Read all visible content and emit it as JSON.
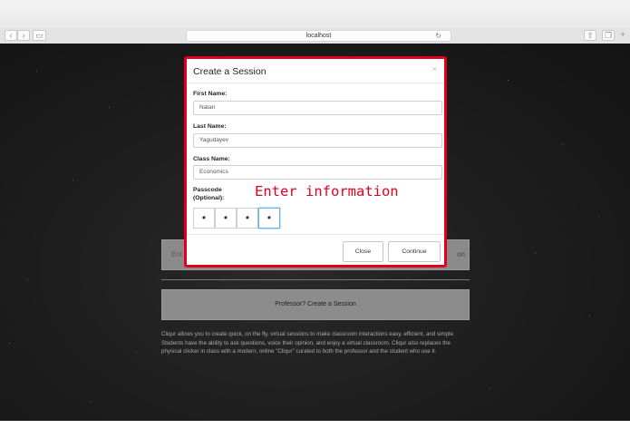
{
  "browser": {
    "url": "localhost",
    "back_icon": "chevron-left-icon",
    "forward_icon": "chevron-right-icon",
    "sidebar_icon": "sidebar-icon",
    "reload_icon": "reload-icon",
    "share_icon": "share-icon",
    "tabs_icon": "tabs-icon",
    "new_tab_icon": "plus-icon"
  },
  "background": {
    "enter_prefix": "Ent",
    "enter_suffix": "on",
    "professor_button": "Professor? Create a Session",
    "description": "Cliqur allows you to create quick, on the fly, virtual sessions to make classroom interactions easy, efficient, and simple. Students have the ability to ask questions, voice their opinion, and enjoy a virtual classroom. Cliqur also replaces the physical clicker in class with a modern, online \"Cliqur\" curated to both the professor and the student who use it."
  },
  "modal": {
    "title": "Create a Session",
    "close_symbol": "×",
    "first_name_label": "First Name:",
    "first_name_value": "Natan",
    "last_name_label": "Last Name:",
    "last_name_value": "Yagudayev",
    "class_name_label": "Class Name:",
    "class_name_value": "Economics",
    "passcode_label": "Passcode (Optional):",
    "passcode_digits": [
      "•",
      "•",
      "•",
      "•"
    ],
    "annotation": "Enter information",
    "close_button": "Close",
    "continue_button": "Continue"
  },
  "colors": {
    "annotation_red": "#e0001b",
    "focus_blue": "#66afe9"
  }
}
